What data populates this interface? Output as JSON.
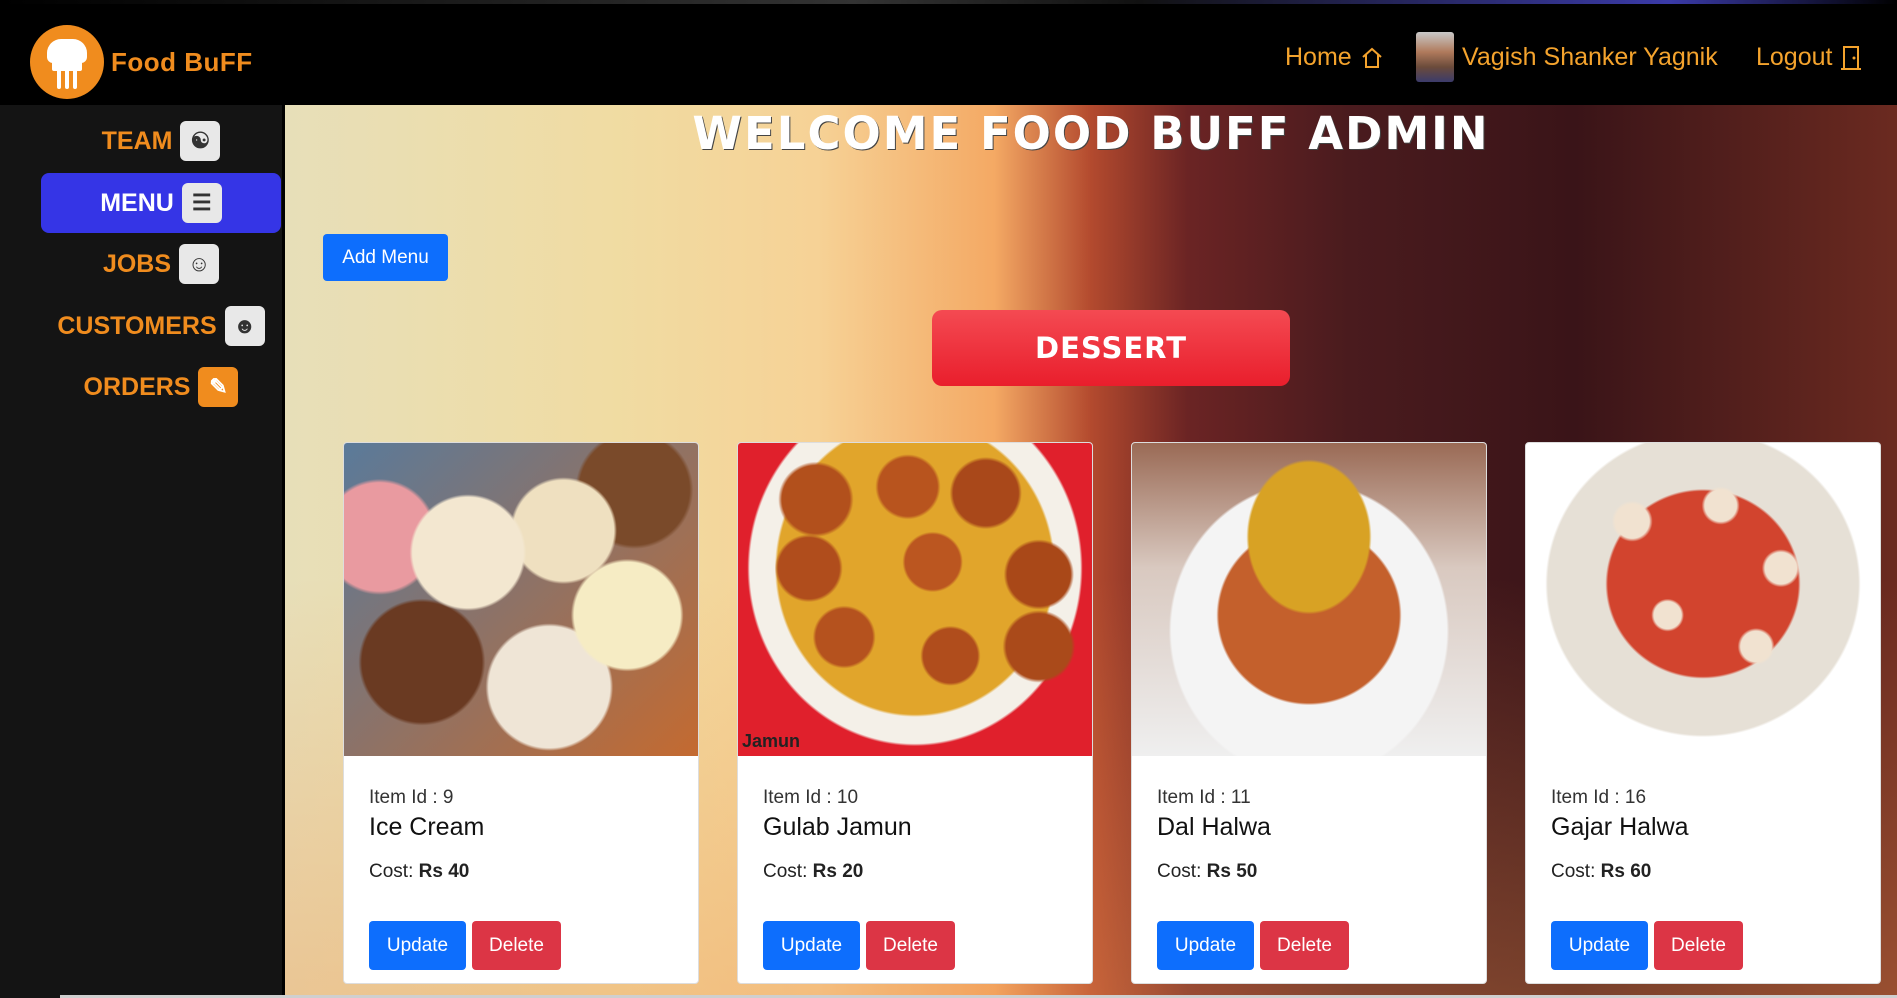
{
  "app": {
    "brand": "Food BuFF"
  },
  "topnav": {
    "home_label": "Home",
    "user_name": "Vagish Shanker Yagnik",
    "logout_label": "Logout"
  },
  "sidebar": {
    "items": [
      {
        "label": "TEAM",
        "icon": "team-icon"
      },
      {
        "label": "MENU",
        "icon": "menu-icon",
        "active": true
      },
      {
        "label": "JOBS",
        "icon": "chef-icon"
      },
      {
        "label": "CUSTOMERS",
        "icon": "customers-icon"
      },
      {
        "label": "ORDERS",
        "icon": "orders-icon"
      }
    ]
  },
  "main": {
    "title": "WELCOME FOOD BUFF ADMIN",
    "add_menu_label": "Add Menu",
    "category": "DESSERT",
    "cards": [
      {
        "item_id": "Item Id : 9",
        "name": "Ice Cream",
        "cost_label": "Cost:",
        "cost_value": "Rs 40",
        "image_label": "",
        "update_label": "Update",
        "delete_label": "Delete"
      },
      {
        "item_id": "Item Id : 10",
        "name": "Gulab Jamun",
        "cost_label": "Cost:",
        "cost_value": "Rs 20",
        "image_label": "Jamun",
        "update_label": "Update",
        "delete_label": "Delete"
      },
      {
        "item_id": "Item Id : 11",
        "name": "Dal Halwa",
        "cost_label": "Cost:",
        "cost_value": "Rs 50",
        "image_label": "",
        "update_label": "Update",
        "delete_label": "Delete"
      },
      {
        "item_id": "Item Id : 16",
        "name": "Gajar Halwa",
        "cost_label": "Cost:",
        "cost_value": "Rs 60",
        "image_label": "",
        "update_label": "Update",
        "delete_label": "Delete"
      }
    ]
  },
  "colors": {
    "accent_orange": "#f08c1e",
    "primary_blue": "#0d6efd",
    "danger_red": "#dc3545",
    "active_sidebar": "#3535e6"
  }
}
